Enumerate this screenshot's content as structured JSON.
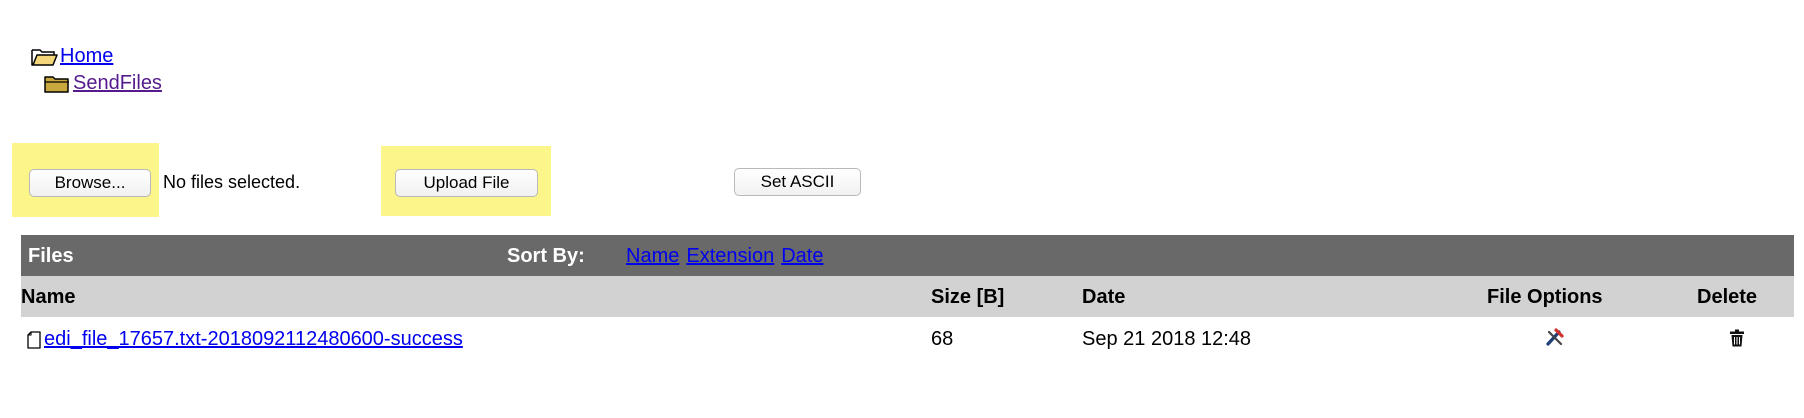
{
  "breadcrumb": {
    "items": [
      {
        "label": "Home",
        "icon": "open-folder-icon"
      },
      {
        "label": "SendFiles",
        "icon": "folder-icon"
      }
    ]
  },
  "upload": {
    "browse_label": "Browse...",
    "file_status": "No files selected.",
    "upload_label": "Upload File",
    "ascii_label": "Set ASCII",
    "highlight_color": "#fcf58a"
  },
  "files_panel": {
    "title": "Files",
    "sort_by_label": "Sort By:",
    "sort_options": [
      "Name",
      "Extension",
      "Date"
    ],
    "header_color": "#696969"
  },
  "columns": {
    "name": "Name",
    "size": "Size [B]",
    "date": "Date",
    "options": "File Options",
    "delete": "Delete"
  },
  "rows": [
    {
      "name": "edi_file_17657.txt-2018092112480600-success",
      "size": "68",
      "date": "Sep 21 2018 12:48",
      "type_icon": "file-icon",
      "options_icon": "tools-icon",
      "delete_icon": "trash-icon"
    }
  ]
}
